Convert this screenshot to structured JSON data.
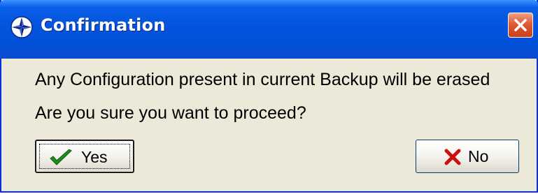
{
  "window": {
    "title": "Confirmation",
    "icons": {
      "app": "compass-icon",
      "close": "close-icon"
    }
  },
  "message": {
    "line1": "Any Configuration present in current Backup will be erased",
    "line2": "Are you sure you want to proceed?"
  },
  "buttons": {
    "yes": {
      "label": "Yes",
      "icon": "checkmark-icon",
      "focused": true
    },
    "no": {
      "label": "No",
      "icon": "x-mark-icon"
    }
  },
  "colors": {
    "title_bar": "#0453dc",
    "dialog_bg": "#ece9d8",
    "close_button": "#e05a34",
    "check_green": "#1e8c1e",
    "x_red": "#cc1010"
  }
}
